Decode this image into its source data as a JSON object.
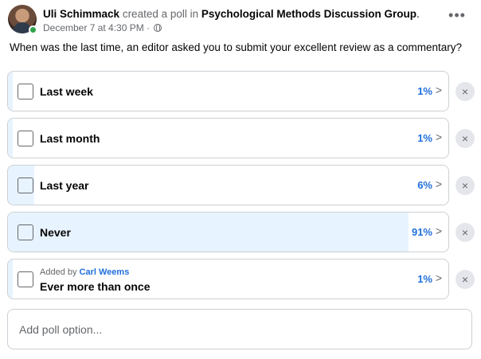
{
  "post": {
    "author": "Uli Schimmack",
    "verb": "created a poll in",
    "group": "Psychological Methods Discussion Group",
    "group_suffix": ".",
    "timestamp": "December 7 at 4:30 PM",
    "separator": "·",
    "more_icon": "more-options-icon",
    "more_label": "•••",
    "privacy_icon": "globe-icon"
  },
  "poll": {
    "question": "When was the last time, an editor asked you to submit your excellent review as a commentary?",
    "accent": "#216fdb",
    "fill_color": "#e7f3ff",
    "options": [
      {
        "label": "Last week",
        "percent": "1%",
        "share": 0.01
      },
      {
        "label": "Last month",
        "percent": "1%",
        "share": 0.01
      },
      {
        "label": "Last year",
        "percent": "6%",
        "share": 0.06
      },
      {
        "label": "Never",
        "percent": "91%",
        "share": 0.91
      },
      {
        "label": "Ever more than once",
        "percent": "1%",
        "share": 0.01,
        "added_by_prefix": "Added by",
        "added_by": "Carl Weems"
      }
    ],
    "chevron": ">",
    "remove_label": "×",
    "add_placeholder": "Add poll option..."
  }
}
